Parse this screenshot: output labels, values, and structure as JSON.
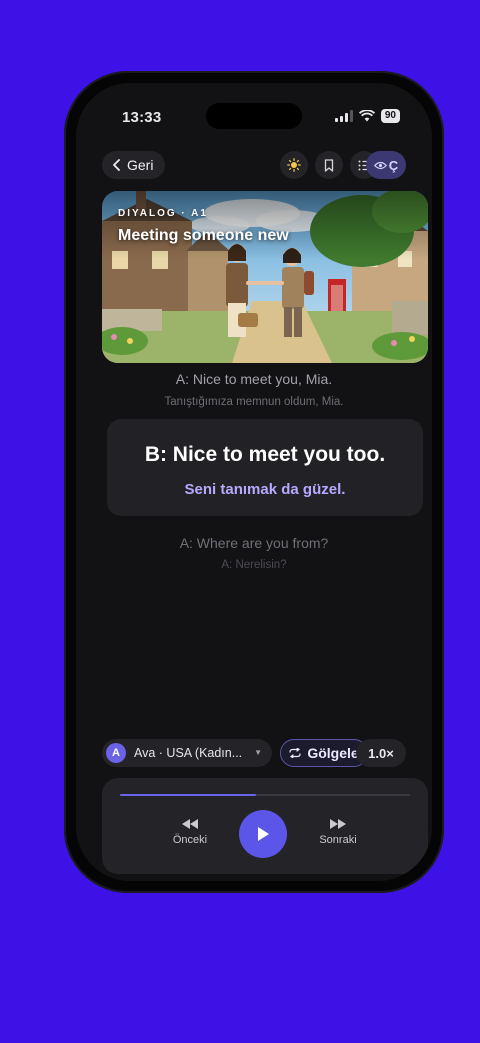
{
  "status": {
    "time": "13:33",
    "battery": "90"
  },
  "top_bar": {
    "back_label": "Geri",
    "eye_label": "Ç"
  },
  "hero": {
    "tag": "DIYALOG · A1",
    "title": "Meeting someone new"
  },
  "dialog": {
    "previous": {
      "en": "A: Nice to meet you, Mia.",
      "tr": "Tanıştığımıza memnun oldum, Mia."
    },
    "current": {
      "en": "B: Nice to meet you too.",
      "tr": "Seni tanımak da güzel."
    },
    "next": {
      "en": "A: Where are you from?",
      "tr": "A: Nerelisin?"
    }
  },
  "voice": {
    "initial": "A",
    "label": "Ava · USA (Kadın...",
    "shadow_label": "Gölgele",
    "speed": "1.0×"
  },
  "player": {
    "progress": 0.47,
    "prev_label": "Önceki",
    "next_label": "Sonraki"
  },
  "colors": {
    "background": "#3d12e6",
    "accent": "#5c56e8",
    "highlight": "#b7a9ff"
  }
}
